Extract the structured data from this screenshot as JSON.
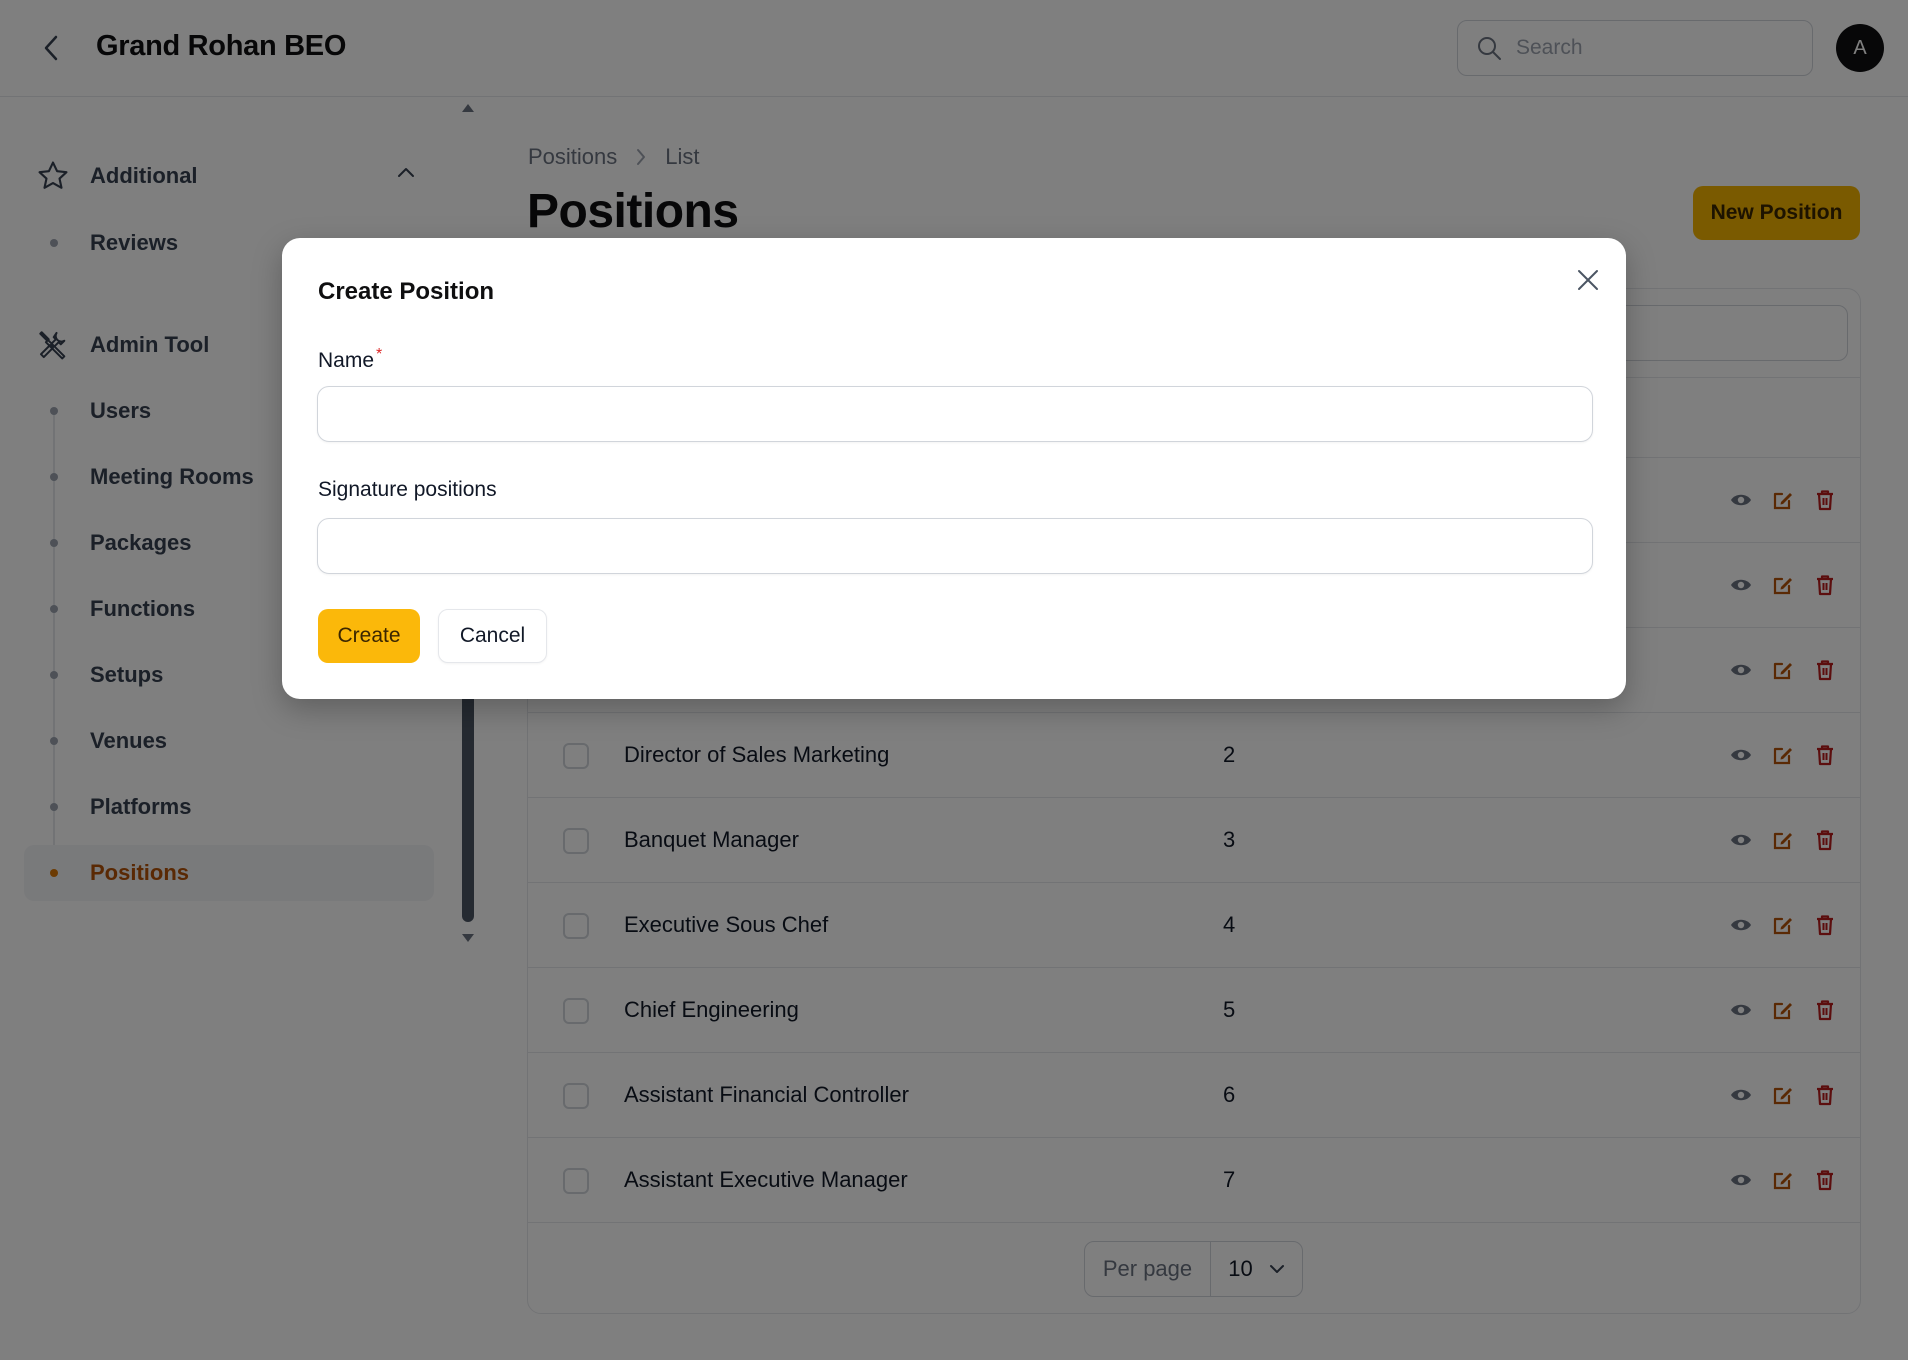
{
  "header": {
    "title": "Grand Rohan BEO",
    "search_placeholder": "Search",
    "avatar_initial": "A"
  },
  "sidebar": {
    "groups": [
      {
        "label": "Additional",
        "icon": "star-icon",
        "items": [
          {
            "label": "Reviews"
          }
        ]
      },
      {
        "label": "Admin Tool",
        "icon": "tools-icon",
        "items": [
          {
            "label": "Users"
          },
          {
            "label": "Meeting Rooms"
          },
          {
            "label": "Packages"
          },
          {
            "label": "Functions"
          },
          {
            "label": "Setups"
          },
          {
            "label": "Venues"
          },
          {
            "label": "Platforms"
          },
          {
            "label": "Positions",
            "active": true
          }
        ]
      }
    ]
  },
  "breadcrumb": {
    "items": [
      "Positions",
      "List"
    ]
  },
  "page": {
    "title": "Positions",
    "new_button": "New Position"
  },
  "table": {
    "rows": [
      {
        "name": "Director of Sales Marketing",
        "value": "2"
      },
      {
        "name": "Banquet Manager",
        "value": "3"
      },
      {
        "name": "Executive Sous Chef",
        "value": "4"
      },
      {
        "name": "Chief Engineering",
        "value": "5"
      },
      {
        "name": "Assistant Financial Controller",
        "value": "6"
      },
      {
        "name": "Assistant Executive Manager",
        "value": "7"
      }
    ],
    "pagination": {
      "per_page_label": "Per page",
      "per_page_value": "10"
    }
  },
  "modal": {
    "title": "Create Position",
    "name_label": "Name",
    "name_required_mark": "*",
    "name_value": "",
    "signature_label": "Signature positions",
    "signature_value": "",
    "create_button": "Create",
    "cancel_button": "Cancel"
  },
  "colors": {
    "accent": "#fbb80a",
    "active_nav": "#b45309",
    "delete_icon": "#b91c1c",
    "edit_icon": "#b45309",
    "view_icon": "#6b7280"
  }
}
